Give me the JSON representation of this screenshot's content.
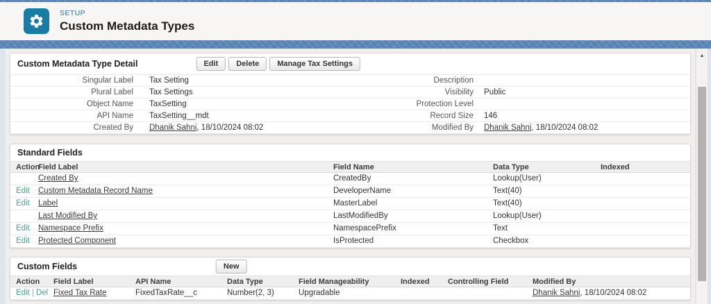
{
  "colors": {
    "band_blue": "#5e8ab9",
    "setup_accent": "#1a7ba3",
    "action_link_green": "#48a08a",
    "section_border": "#d8d8d8"
  },
  "icons": {
    "scroll_up": "▲"
  },
  "header": {
    "eyebrow": "SETUP",
    "title": "Custom Metadata Types"
  },
  "detail": {
    "title": "Custom Metadata Type Detail",
    "buttons": [
      "Edit",
      "Delete",
      "Manage Tax Settings"
    ],
    "rows": [
      {
        "l_label": "Singular Label",
        "l_value": "Tax Setting",
        "r_label": "Description",
        "r_value": ""
      },
      {
        "l_label": "Plural Label",
        "l_value": "Tax Settings",
        "r_label": "Visibility",
        "r_value": "Public"
      },
      {
        "l_label": "Object Name",
        "l_value": "TaxSetting",
        "r_label": "Protection Level",
        "r_value": ""
      },
      {
        "l_label": "API Name",
        "l_value": "TaxSetting__mdt",
        "r_label": "Record Size",
        "r_value": "146"
      },
      {
        "l_label": "Created By",
        "l_value_link": "Dhanik Sahni",
        "l_value_rest": ", 18/10/2024 08:02",
        "r_label": "Modified By",
        "r_value_link": "Dhanik Sahni",
        "r_value_rest": ", 18/10/2024 08:02"
      }
    ]
  },
  "standard_fields": {
    "title": "Standard Fields",
    "columns": [
      "Action",
      "Field Label",
      "Field Name",
      "Data Type",
      "Indexed"
    ],
    "rows": [
      {
        "action": "",
        "label": "Created By",
        "name": "CreatedBy",
        "type": "Lookup(User)",
        "indexed": ""
      },
      {
        "action": "Edit",
        "label": "Custom Metadata Record Name",
        "name": "DeveloperName",
        "type": "Text(40)",
        "indexed": ""
      },
      {
        "action": "Edit",
        "label": "Label",
        "name": "MasterLabel",
        "type": "Text(40)",
        "indexed": ""
      },
      {
        "action": "",
        "label": "Last Modified By",
        "name": "LastModifiedBy",
        "type": "Lookup(User)",
        "indexed": ""
      },
      {
        "action": "Edit",
        "label": "Namespace Prefix",
        "name": "NamespacePrefix",
        "type": "Text",
        "indexed": ""
      },
      {
        "action": "Edit",
        "label": "Protected Component",
        "name": "IsProtected",
        "type": "Checkbox",
        "indexed": ""
      }
    ]
  },
  "custom_fields": {
    "title": "Custom Fields",
    "new_button": "New",
    "columns": [
      "Action",
      "Field Label",
      "API Name",
      "Data Type",
      "Field Manageability",
      "Indexed",
      "Controlling Field",
      "Modified By"
    ],
    "rows": [
      {
        "action_edit": "Edit",
        "action_sep": "|",
        "action_del": "Del",
        "label": "Fixed Tax Rate",
        "api_name": "FixedTaxRate__c",
        "type": "Number(2, 3)",
        "manageability": "Upgradable",
        "indexed": "",
        "controlling": "",
        "modified_link": "Dhanik Sahni",
        "modified_rest": ", 18/10/2024 08:02"
      }
    ]
  }
}
